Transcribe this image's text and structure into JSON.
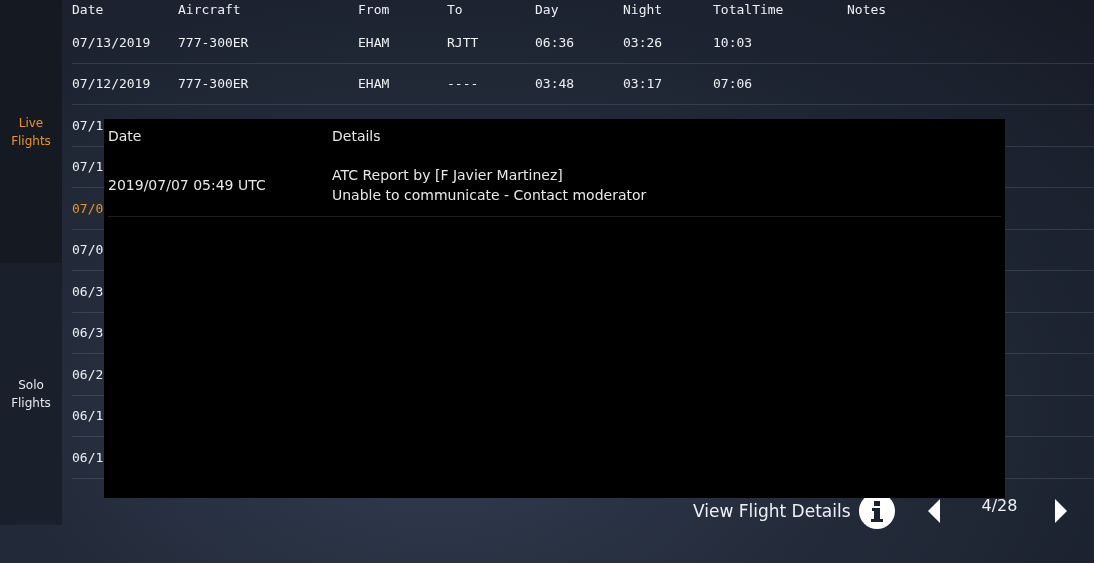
{
  "sidebar": {
    "items": [
      {
        "label": "Live Flights",
        "selected": true
      },
      {
        "label": "Solo Flights",
        "selected": false
      }
    ]
  },
  "table": {
    "columns": [
      "Date",
      "Aircraft",
      "From",
      "To",
      "Day",
      "Night",
      "TotalTime",
      "Notes"
    ],
    "rows": [
      {
        "cells": [
          "07/13/2019",
          "777-300ER",
          "EHAM",
          "RJTT",
          "06:36",
          "03:26",
          "10:03"
        ],
        "selected": false
      },
      {
        "cells": [
          "07/12/2019",
          "777-300ER",
          "EHAM",
          "----",
          "03:48",
          "03:17",
          "07:06"
        ],
        "selected": false
      },
      {
        "cells": [
          "07/1"
        ],
        "selected": false
      },
      {
        "cells": [
          "07/1"
        ],
        "selected": false
      },
      {
        "cells": [
          "07/0"
        ],
        "selected": true
      },
      {
        "cells": [
          "07/0"
        ],
        "selected": false
      },
      {
        "cells": [
          "06/3"
        ],
        "selected": false
      },
      {
        "cells": [
          "06/3"
        ],
        "selected": false
      },
      {
        "cells": [
          "06/2"
        ],
        "selected": false
      },
      {
        "cells": [
          "06/1"
        ],
        "selected": false
      },
      {
        "cells": [
          "06/1"
        ],
        "selected": false
      }
    ]
  },
  "dialog": {
    "columns": [
      "Date",
      "Details"
    ],
    "rows": [
      {
        "date": "2019/07/07 05:49 UTC",
        "details": [
          "ATC Report by [F Javier Martinez]",
          "Unable to communicate - Contact moderator"
        ]
      }
    ]
  },
  "footer": {
    "details_label": "View Flight Details",
    "page": "4/28"
  }
}
